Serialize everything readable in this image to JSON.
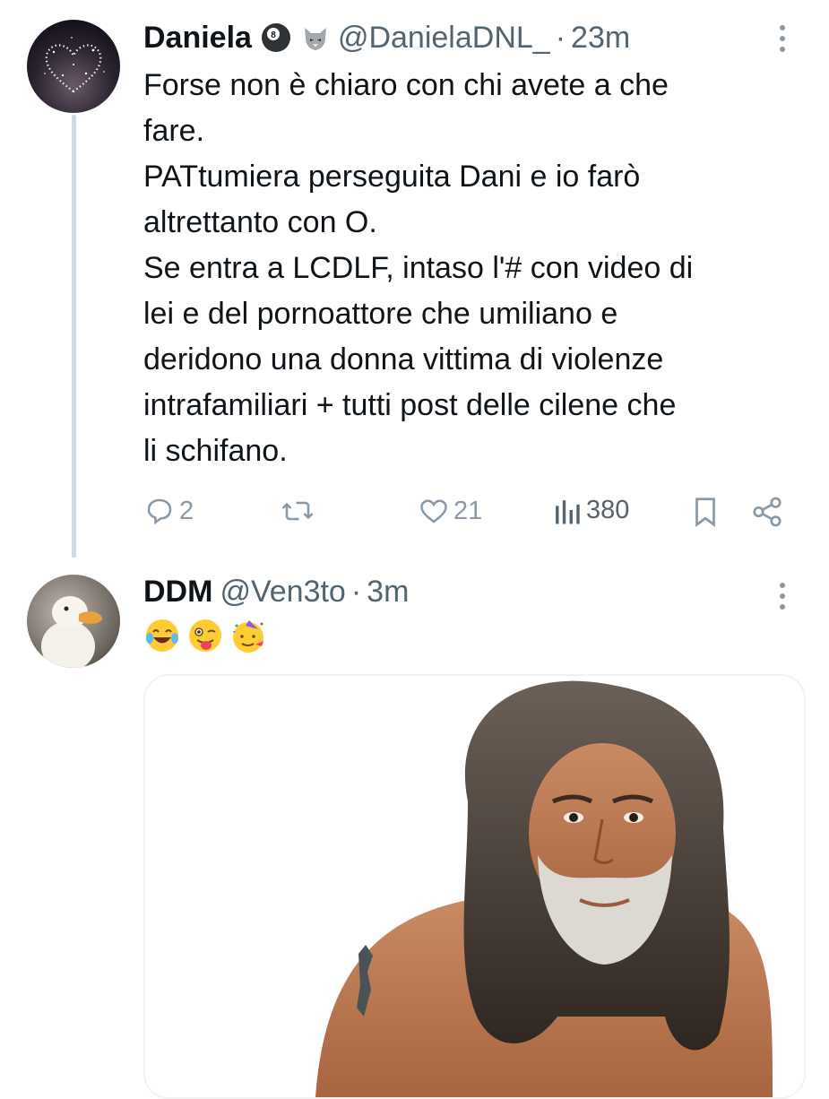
{
  "tweet1": {
    "author_name": "Daniela",
    "handle": "@DanielaDNL_",
    "separator": "·",
    "time": "23m",
    "badges": [
      "8-ball-icon",
      "wolf-icon"
    ],
    "text": "Forse non è chiaro con chi avete a che\nfare.\nPATtumiera perseguita Dani e io farò\naltrettanto con O.\nSe entra a LCDLF, intaso l'# con video di\nlei e del pornoattore che umiliano e\nderidono una donna vittima di violenze\nintrafamiliari + tutti post delle cilene che\nli schifano.",
    "actions": {
      "replies": "2",
      "retweets": "",
      "likes": "21",
      "views": "380"
    }
  },
  "tweet2": {
    "author_name": "DDM",
    "handle": "@Ven3to",
    "separator": "·",
    "time": "3m",
    "emojis": [
      "😂",
      "😜",
      "🥳"
    ],
    "media": {
      "icon": "photo-man-long-gray-hair"
    }
  },
  "colors": {
    "text_primary": "#0f1419",
    "text_secondary": "#536471",
    "icon_gray": "#8b98a5",
    "thread_line": "#cfd9de",
    "accent_blue": "#1d9bf0"
  }
}
